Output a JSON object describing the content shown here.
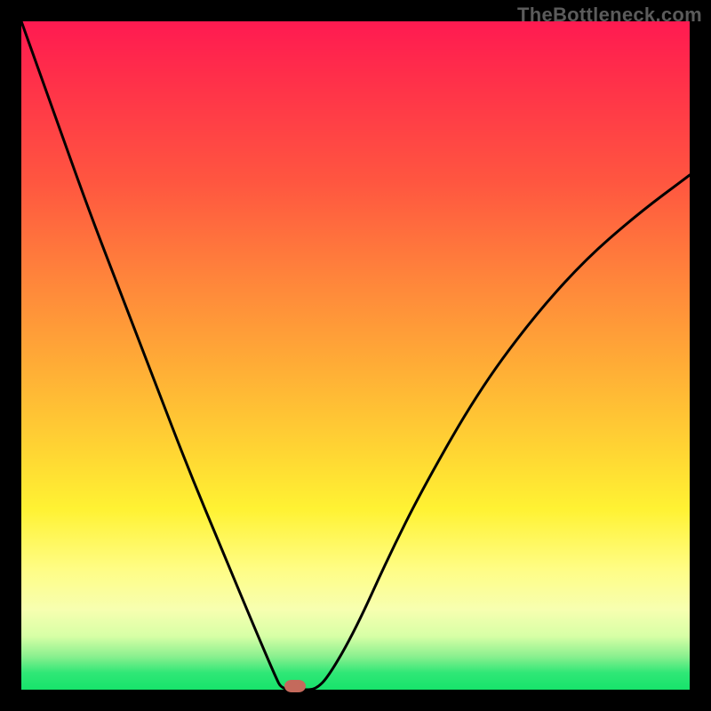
{
  "watermark": "TheBottleneck.com",
  "colors": {
    "frame_bg": "#000000",
    "curve_stroke": "#000000",
    "marker_fill": "#c46a5c",
    "watermark_text": "#5b5b5b"
  },
  "chart_data": {
    "type": "line",
    "title": "",
    "xlabel": "",
    "ylabel": "",
    "xlim": [
      0,
      1
    ],
    "ylim": [
      0,
      1
    ],
    "note": "Axes are unlabeled; values are normalized estimates read from pixel positions. y=1 at top, y=0 at bottom; x=0 at left, x=1 at right.",
    "series": [
      {
        "name": "curve",
        "x": [
          0.0,
          0.05,
          0.1,
          0.15,
          0.2,
          0.25,
          0.3,
          0.35,
          0.38,
          0.39,
          0.42,
          0.44,
          0.46,
          0.5,
          0.55,
          0.6,
          0.68,
          0.76,
          0.84,
          0.92,
          1.0
        ],
        "y": [
          1.0,
          0.86,
          0.72,
          0.59,
          0.46,
          0.33,
          0.21,
          0.09,
          0.02,
          0.0,
          0.0,
          0.0,
          0.02,
          0.09,
          0.2,
          0.3,
          0.44,
          0.55,
          0.64,
          0.71,
          0.77
        ]
      }
    ],
    "marker": {
      "x": 0.41,
      "y": 0.0
    },
    "gradient_stops": [
      {
        "pos": 0.0,
        "color": "#ff1a51"
      },
      {
        "pos": 0.08,
        "color": "#ff2e4a"
      },
      {
        "pos": 0.24,
        "color": "#ff5640"
      },
      {
        "pos": 0.38,
        "color": "#ff833b"
      },
      {
        "pos": 0.52,
        "color": "#ffae36"
      },
      {
        "pos": 0.64,
        "color": "#ffd433"
      },
      {
        "pos": 0.73,
        "color": "#fff233"
      },
      {
        "pos": 0.82,
        "color": "#fffd85"
      },
      {
        "pos": 0.88,
        "color": "#f7ffb0"
      },
      {
        "pos": 0.92,
        "color": "#d7ffa6"
      },
      {
        "pos": 0.95,
        "color": "#8bf08f"
      },
      {
        "pos": 0.975,
        "color": "#2fe776"
      },
      {
        "pos": 1.0,
        "color": "#17e36b"
      }
    ]
  }
}
